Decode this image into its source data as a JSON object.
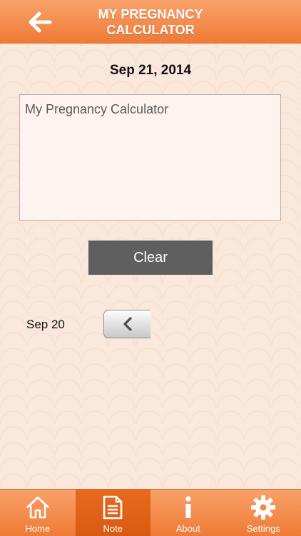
{
  "header": {
    "title_line1": "MY PREGNANCY",
    "title_line2": "CALCULATOR"
  },
  "note": {
    "date": "Sep 21, 2014",
    "text": "My Pregnancy Calculator",
    "clear_label": "Clear"
  },
  "navigation": {
    "prev_date": "Sep 20"
  },
  "tabbar": {
    "active": "Note",
    "tabs": [
      {
        "label": "Home",
        "icon": "home-icon"
      },
      {
        "label": "Note",
        "icon": "note-icon"
      },
      {
        "label": "About",
        "icon": "info-icon"
      },
      {
        "label": "Settings",
        "icon": "gear-icon"
      }
    ]
  },
  "colors": {
    "accent": "#f08a4b",
    "active_tab": "#e0621a",
    "button": "#5f5f5f"
  }
}
